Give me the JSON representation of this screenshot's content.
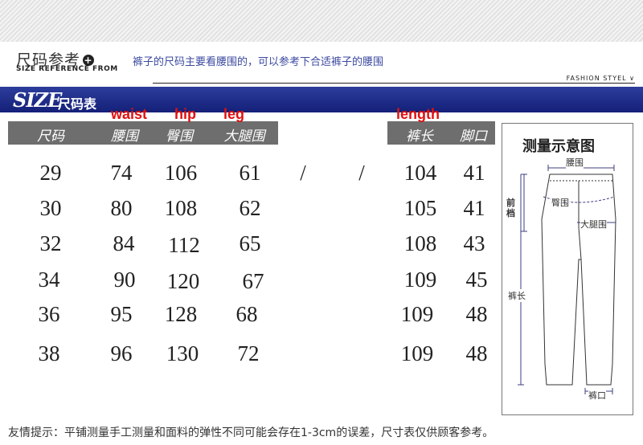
{
  "header": {
    "title": "尺码参考",
    "plus_glyph": "+",
    "subtitle": "SIZE REFERENCE FROM",
    "note": "裤子的尺码主要看腰围的，可以参考下合适裤子的腰围",
    "fashion_label": "FASHION STYEL"
  },
  "size_bar": {
    "size_word": "SIZE",
    "size_cn": "尺码表"
  },
  "annotations": {
    "waist": "waist",
    "hip": "hip",
    "leg": "leg",
    "length": "length"
  },
  "table": {
    "headers": [
      "尺码",
      "腰围",
      "臀围",
      "大腿围",
      "裤长",
      "脚口"
    ],
    "empty_marks": [
      "/",
      "/"
    ],
    "rows": [
      [
        "29",
        "74",
        "106",
        "61",
        "104",
        "41"
      ],
      [
        "30",
        "80",
        "108",
        "62",
        "105",
        "41"
      ],
      [
        "32",
        "84",
        "112",
        "65",
        "108",
        "43"
      ],
      [
        "34",
        "90",
        "120",
        "67",
        "109",
        "45"
      ],
      [
        "36",
        "95",
        "128",
        "68",
        "109",
        "48"
      ],
      [
        "38",
        "96",
        "130",
        "72",
        "109",
        "48"
      ]
    ]
  },
  "diagram": {
    "title": "测量示意图",
    "waist": "腰围",
    "rise": "前档",
    "hip": "臀围",
    "thigh": "大腿围",
    "length": "裤长",
    "hem": "裤口"
  },
  "footer": "友情提示：平铺测量手工测量和面料的弹性不同可能会存在1-3cm的误差，尺寸表仅供顾客参考。",
  "colors": {
    "brand_bar": "#1f2d8a",
    "annotation": "#e01010",
    "header_gray": "#6e6e6e",
    "note": "#3c4aa0"
  }
}
